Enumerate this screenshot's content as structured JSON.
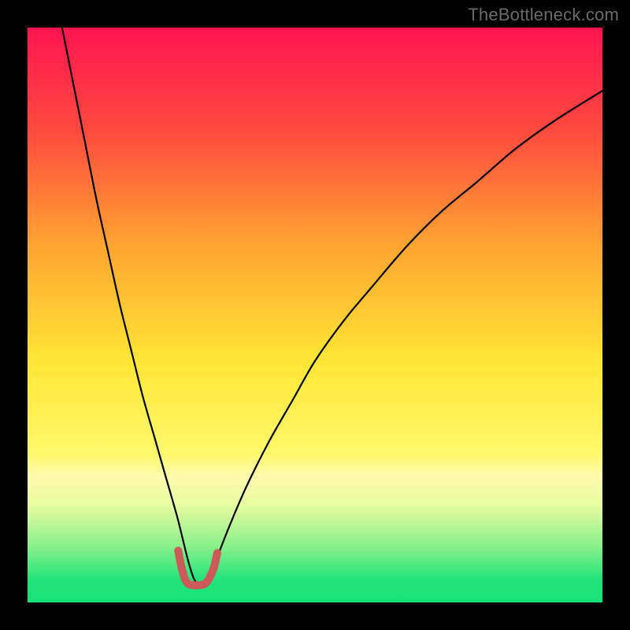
{
  "watermark": "TheBottleneck.com",
  "chart_data": {
    "type": "line",
    "title": "",
    "xlabel": "",
    "ylabel": "",
    "xlim": [
      0,
      100
    ],
    "ylim": [
      0,
      100
    ],
    "grid": false,
    "legend": false,
    "gradient_stops": [
      {
        "offset": 0,
        "color": "#ff1450"
      },
      {
        "offset": 18,
        "color": "#ff4a3e"
      },
      {
        "offset": 38,
        "color": "#ffa531"
      },
      {
        "offset": 58,
        "color": "#ffe635"
      },
      {
        "offset": 74,
        "color": "#fff86a"
      },
      {
        "offset": 78,
        "color": "#fffbad"
      },
      {
        "offset": 83,
        "color": "#e7fca0"
      },
      {
        "offset": 90,
        "color": "#8df08b"
      },
      {
        "offset": 96,
        "color": "#22e47a"
      },
      {
        "offset": 100,
        "color": "#17e376"
      }
    ],
    "series": [
      {
        "name": "bottleneck-curve",
        "color": "#000000",
        "x": [
          6,
          8,
          10,
          12,
          14,
          16,
          18,
          20,
          22,
          24,
          26,
          27,
          28,
          29,
          30,
          31,
          33,
          35,
          38,
          42,
          46,
          50,
          55,
          60,
          66,
          72,
          78,
          85,
          92,
          100
        ],
        "y": [
          100,
          90,
          80,
          70,
          61,
          52,
          44,
          36,
          29,
          22,
          15,
          11,
          7,
          4,
          3,
          4,
          8,
          13,
          20,
          28,
          35,
          42,
          49,
          55,
          62,
          68,
          73,
          79,
          84,
          89
        ]
      },
      {
        "name": "optimal-region",
        "color": "#cc5a59",
        "stroke_width": 10,
        "x": [
          26.2,
          26.8,
          27.4,
          28.0,
          28.8,
          29.8,
          30.8,
          31.6,
          32.4,
          33.0
        ],
        "y": [
          9.0,
          6.0,
          4.0,
          3.2,
          3.0,
          3.0,
          3.2,
          4.2,
          6.0,
          8.6
        ]
      }
    ]
  }
}
